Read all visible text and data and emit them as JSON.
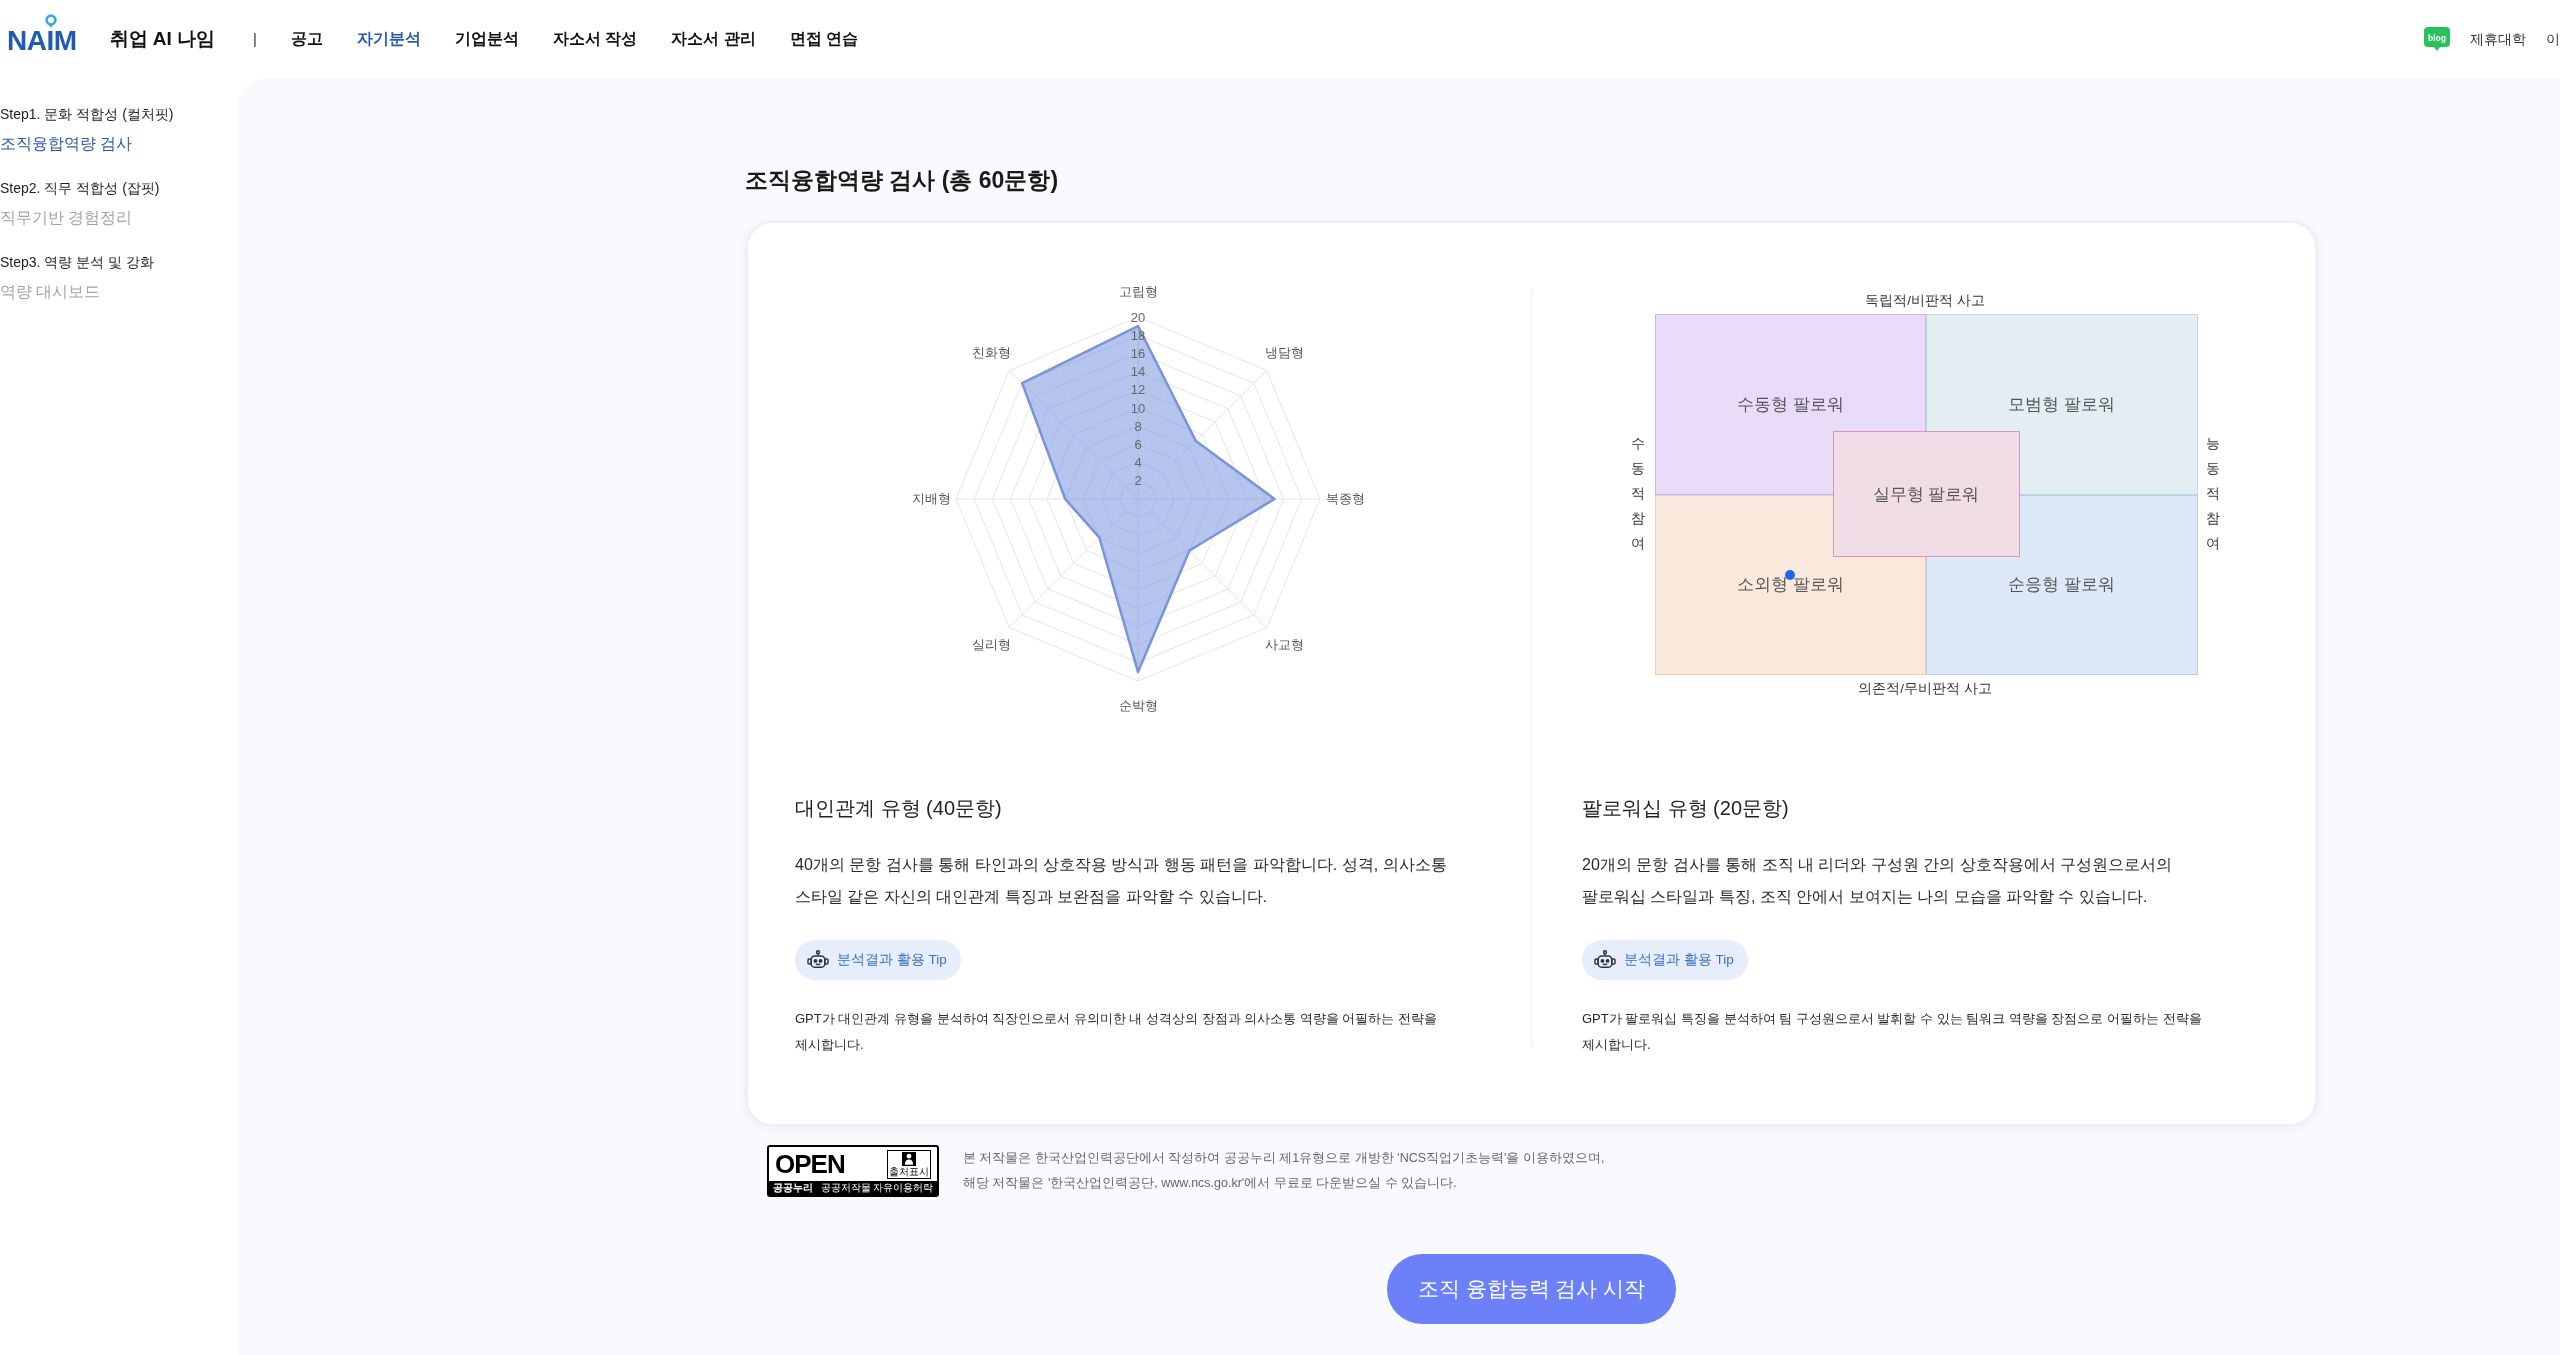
{
  "header": {
    "logo": "NAIM",
    "brand": "취업 AI 나임",
    "separator": "|",
    "nav": [
      {
        "label": "공고",
        "selected": false
      },
      {
        "label": "자기분석",
        "selected": true
      },
      {
        "label": "기업분석",
        "selected": false
      },
      {
        "label": "자소서 작성",
        "selected": false
      },
      {
        "label": "자소서 관리",
        "selected": false
      },
      {
        "label": "면접 연습",
        "selected": false
      }
    ],
    "links": [
      {
        "kind": "blog",
        "label": "blog"
      },
      {
        "kind": "text",
        "label": "제휴대학"
      },
      {
        "kind": "text",
        "label": "이"
      }
    ]
  },
  "sidebar": [
    {
      "step": "Step1. 문화 적합성 (컬처핏)",
      "items": [
        {
          "label": "조직융합역량 검사",
          "selected": true
        }
      ]
    },
    {
      "step": "Step2. 직무 적합성 (잡핏)",
      "items": [
        {
          "label": "직무기반 경험정리",
          "selected": false
        }
      ]
    },
    {
      "step": "Step3. 역량 분석 및 강화",
      "items": [
        {
          "label": "역량 대시보드",
          "selected": false
        }
      ]
    }
  ],
  "page_title": "조직융합역량 검사 (총 60문항)",
  "interpersonal": {
    "chart_data": {
      "type": "radar",
      "categories": [
        "고립형",
        "냉담형",
        "복종형",
        "사교형",
        "순박형",
        "실리형",
        "지배형",
        "친화형"
      ],
      "series": [
        {
          "values": [
            19,
            9,
            15,
            8,
            19,
            6,
            8,
            18
          ]
        }
      ],
      "ylim": [
        0,
        20
      ],
      "yticks": [
        2,
        4,
        6,
        8,
        10,
        12,
        14,
        16,
        18,
        20
      ]
    },
    "heading": "대인관계 유형 (40문항)",
    "description": "40개의 문항 검사를 통해 타인과의 상호작용 방식과 행동 패턴을 파악합니다. 성격, 의사소통 스타일 같은 자신의 대인관계 특징과 보완점을 파악할 수 있습니다.",
    "tip": "분석결과 활용 Tip",
    "note": "GPT가 대인관계 유형을 분석하여 직장인으로서 유의미한 내 성격상의 장점과 의사소통 역량을 어필하는 전략을 제시합니다."
  },
  "followership": {
    "matrix": {
      "top_label": "독립적/비판적 사고",
      "bottom_label": "의존적/무비판적 사고",
      "left_label": "수동적 참여",
      "right_label": "능동적 참여",
      "quadrants": [
        {
          "label": "수동형 팔로워",
          "color": "#e8dcf9",
          "marked": false
        },
        {
          "label": "모범형 팔로워",
          "color": "#e2eef1",
          "marked": false
        },
        {
          "label": "소외형 팔로워",
          "color": "#f9e8dc",
          "marked": true
        },
        {
          "label": "순응형 팔로워",
          "color": "#dde9f9",
          "marked": false
        }
      ],
      "center": {
        "label": "실무형 팔로워",
        "color": "#f1dde5"
      }
    },
    "heading": "팔로워십 유형 (20문항)",
    "description": "20개의 문항 검사를 통해 조직 내 리더와 구성원 간의 상호작용에서 구성원으로서의 팔로워십 스타일과 특징, 조직 안에서 보여지는 나의 모습을 파악할 수 있습니다.",
    "tip": "분석결과 활용 Tip",
    "note": "GPT가 팔로워십 특징을 분석하여 팀 구성원으로서 발휘할 수 있는 팀워크 역량을 장점으로 어필하는 전략을 제시합니다."
  },
  "license": {
    "badge": {
      "mark": "OPEN",
      "condition": "출처표시",
      "brand": "공공누리",
      "scheme": "공공저작물 자유이용허락"
    },
    "notice": [
      "본 저작물은 한국산업인력공단에서 작성하여 공공누리 제1유형으로 개방한 'NCS직업기초능력'을 이용하였으며,",
      "해당 저작물은 '한국산업인력공단, www.ncs.go.kr'에서 무료로 다운받으실 수 있습니다."
    ]
  },
  "start_button": "조직 융합능력 검사 시작"
}
